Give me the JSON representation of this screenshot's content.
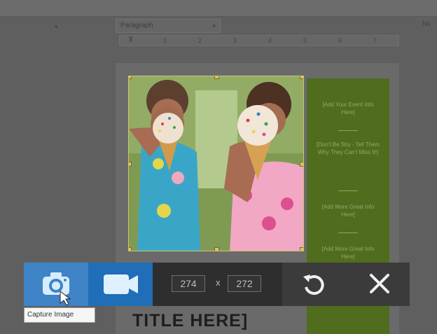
{
  "document": {
    "style_dropdown": "Paragraph",
    "right_label": "Nc",
    "ruler_ticks": [
      "1",
      "2",
      "3",
      "4",
      "5",
      "6",
      "7"
    ],
    "title": "TITLE HERE]",
    "panel_lines": [
      "[Add Your Event Info Here]",
      "[Don't Be Shy - Tell Them Why They Can't Miss It!]",
      "[Add More Great Info Here]",
      "[Add More Great Info Here]"
    ]
  },
  "capture": {
    "width_value": "274",
    "height_value": "272",
    "times_symbol": "x",
    "tooltip": "Capture Image"
  },
  "colors": {
    "capture_active": "#3e84c6",
    "video_button": "#1f6eb7",
    "panel_green": "#4f6d1d"
  },
  "icons": {
    "camera": "camera-icon",
    "video": "video-camera-icon",
    "reset": "reset-icon",
    "close": "close-icon"
  }
}
